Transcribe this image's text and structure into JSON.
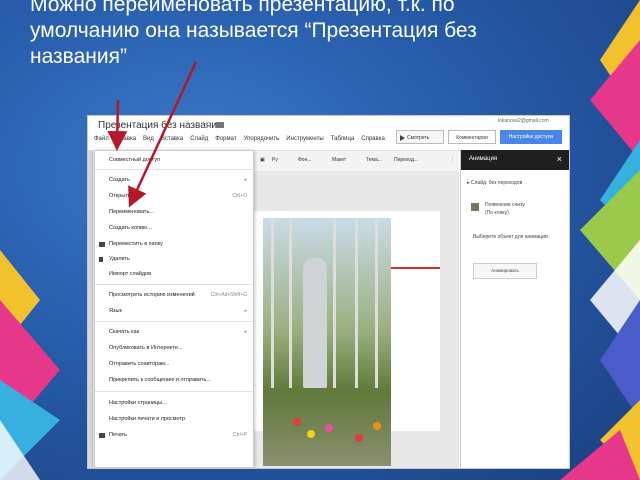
{
  "caption": "Можно переименовать презентацию, т.к. по умолчанию она называется “Презентация без названия”",
  "app": {
    "doc_title": "Презентация без названия",
    "email": "lokanova2@gmail.com",
    "menubar": [
      "Файл",
      "Правка",
      "Вид",
      "Вставка",
      "Слайд",
      "Формат",
      "Упорядочить",
      "Инструменты",
      "Таблица",
      "Справка"
    ],
    "buttons": {
      "show": "Смотреть",
      "comments": "Комментарии",
      "access": "Настройки доступа"
    },
    "toolbar": {
      "font": "Ру",
      "item1": "Фон...",
      "item2": "Макет",
      "item3": "Тема...",
      "item4": "Переход..."
    }
  },
  "file_menu": {
    "items": [
      {
        "label": "Совместный доступ",
        "shortcut": ""
      },
      {
        "label": "Создать",
        "shortcut": "▸"
      },
      {
        "label": "Открыть...",
        "shortcut": "Ctrl+O"
      },
      {
        "label": "Переименовать...",
        "shortcut": ""
      },
      {
        "label": "Создать копию...",
        "shortcut": ""
      },
      {
        "label": "Переместить в папку",
        "shortcut": ""
      },
      {
        "label": "Удалить",
        "shortcut": ""
      },
      {
        "label": "Импорт слайдов",
        "shortcut": ""
      },
      {
        "label": "Просмотреть историю изменений",
        "shortcut": "Ctrl+Alt+Shift+G"
      },
      {
        "label": "Язык",
        "shortcut": "▸"
      },
      {
        "label": "Скачать как",
        "shortcut": "▸"
      },
      {
        "label": "Опубликовать в Интернете...",
        "shortcut": ""
      },
      {
        "label": "Отправить соавторам...",
        "shortcut": ""
      },
      {
        "label": "Прикрепить к сообщению и отправить...",
        "shortcut": ""
      },
      {
        "label": "Настройки страницы...",
        "shortcut": ""
      },
      {
        "label": "Настройки печати и просмотр",
        "shortcut": ""
      },
      {
        "label": "Печать",
        "shortcut": "Ctrl+P"
      }
    ]
  },
  "animation_panel": {
    "title": "Анимация",
    "close": "×",
    "slide_transition": "▸ Слайд: без переходов",
    "item_label": "Появление снизу",
    "item_sub": "(По клику)",
    "hint": "Выберите объект для анимации",
    "add_button": "Анимировать"
  },
  "colors": {
    "accent": "#4a86e8",
    "background": "#1f4e95",
    "arrow": "#b5172b"
  }
}
